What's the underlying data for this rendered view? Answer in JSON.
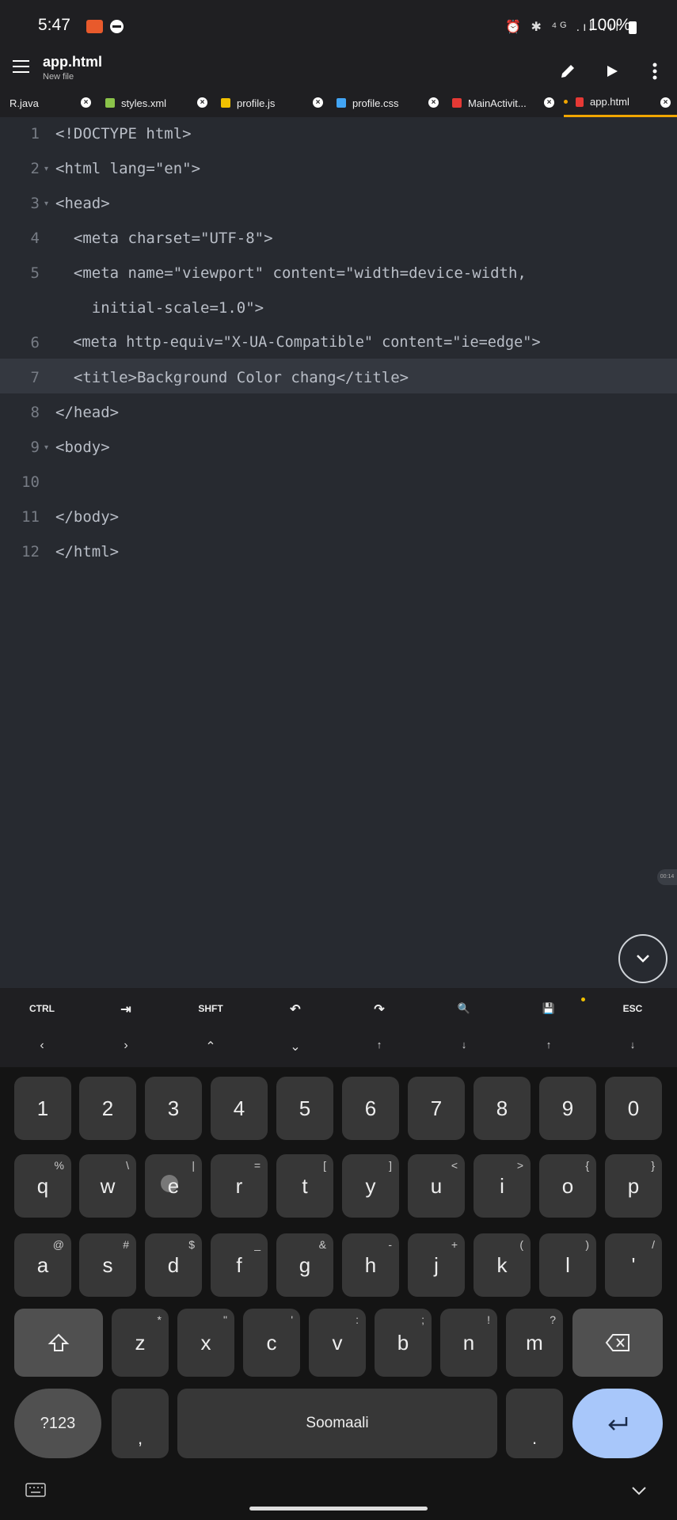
{
  "status_bar": {
    "time": "5:47",
    "battery": "100%",
    "icons": "⏰ ✱ ⁴ᴳ .ıl .ıl"
  },
  "app_bar": {
    "title": "app.html",
    "subtitle": "New file",
    "menu_icon": "hamburger-icon",
    "edit_icon": "pencil-icon",
    "run_icon": "play-icon",
    "more_icon": "more-vert-icon"
  },
  "tabs": [
    {
      "label": "R.java",
      "icon": "",
      "color": ""
    },
    {
      "label": "styles.xml",
      "icon": "xml-file-icon",
      "color": "#8bc34a"
    },
    {
      "label": "profile.js",
      "icon": "js-file-icon",
      "color": "#f0c000"
    },
    {
      "label": "profile.css",
      "icon": "css-file-icon",
      "color": "#42a5f5"
    },
    {
      "label": "MainActivit...",
      "icon": "java-file-icon",
      "color": "#e53935"
    },
    {
      "label": "app.html",
      "icon": "html-file-icon",
      "color": "#e53935",
      "active": true
    }
  ],
  "editor": {
    "lines": [
      {
        "n": "1",
        "text": "<!DOCTYPE html>"
      },
      {
        "n": "2",
        "text": "<html lang=\"en\">"
      },
      {
        "n": "3",
        "text": "<head>"
      },
      {
        "n": "4",
        "text": "  <meta charset=\"UTF-8\">"
      },
      {
        "n": "5",
        "text": "  <meta name=\"viewport\" content=\"width=device-width,"
      },
      {
        "n": "",
        "text": "    initial-scale=1.0\">"
      },
      {
        "n": "6",
        "text": "  <meta http-equiv=\"X-UA-Compatible\" content=\"ie=edge\">"
      },
      {
        "n": "7",
        "text": "  <title>Background Color chang</title>"
      },
      {
        "n": "8",
        "text": "</head>"
      },
      {
        "n": "9",
        "text": "<body>"
      },
      {
        "n": "10",
        "text": "    "
      },
      {
        "n": "11",
        "text": "</body>"
      },
      {
        "n": "12",
        "text": "</html>"
      }
    ],
    "timestamp": "00:14"
  },
  "extra_keys": {
    "row1": [
      "CTRL",
      "⇥",
      "SHFT",
      "↶",
      "↷",
      "🔍",
      "💾",
      "ESC"
    ],
    "row2": [
      "‹",
      "›",
      "⌃",
      "⌄",
      "↑",
      "↓",
      "↑",
      "↓"
    ]
  },
  "keyboard": {
    "numbers": [
      "1",
      "2",
      "3",
      "4",
      "5",
      "6",
      "7",
      "8",
      "9",
      "0"
    ],
    "row1": [
      {
        "k": "q",
        "s": "%"
      },
      {
        "k": "w",
        "s": "\\"
      },
      {
        "k": "e",
        "s": "|"
      },
      {
        "k": "r",
        "s": "="
      },
      {
        "k": "t",
        "s": "["
      },
      {
        "k": "y",
        "s": "]"
      },
      {
        "k": "u",
        "s": "<"
      },
      {
        "k": "i",
        "s": ">"
      },
      {
        "k": "o",
        "s": "{"
      },
      {
        "k": "p",
        "s": "}"
      }
    ],
    "row2": [
      {
        "k": "a",
        "s": "@"
      },
      {
        "k": "s",
        "s": "#"
      },
      {
        "k": "d",
        "s": "$"
      },
      {
        "k": "f",
        "s": "_"
      },
      {
        "k": "g",
        "s": "&"
      },
      {
        "k": "h",
        "s": "-"
      },
      {
        "k": "j",
        "s": "+"
      },
      {
        "k": "k",
        "s": "("
      },
      {
        "k": "l",
        "s": ")"
      },
      {
        "k": "'",
        "s": "/"
      }
    ],
    "row3": [
      {
        "k": "z",
        "s": "*"
      },
      {
        "k": "x",
        "s": "\""
      },
      {
        "k": "c",
        "s": "'"
      },
      {
        "k": "v",
        "s": ":"
      },
      {
        "k": "b",
        "s": ";"
      },
      {
        "k": "n",
        "s": "!"
      },
      {
        "k": "m",
        "s": "?"
      }
    ],
    "symbols_key": "?123",
    "comma": ",",
    "space_label": "Soomaali",
    "period": ".",
    "enter_icon": "enter-icon",
    "shift_icon": "shift-icon",
    "backspace_icon": "backspace-icon"
  },
  "colors": {
    "accent": "#f0a500",
    "enter_key": "#a8c7fa",
    "background": "#272a30"
  }
}
